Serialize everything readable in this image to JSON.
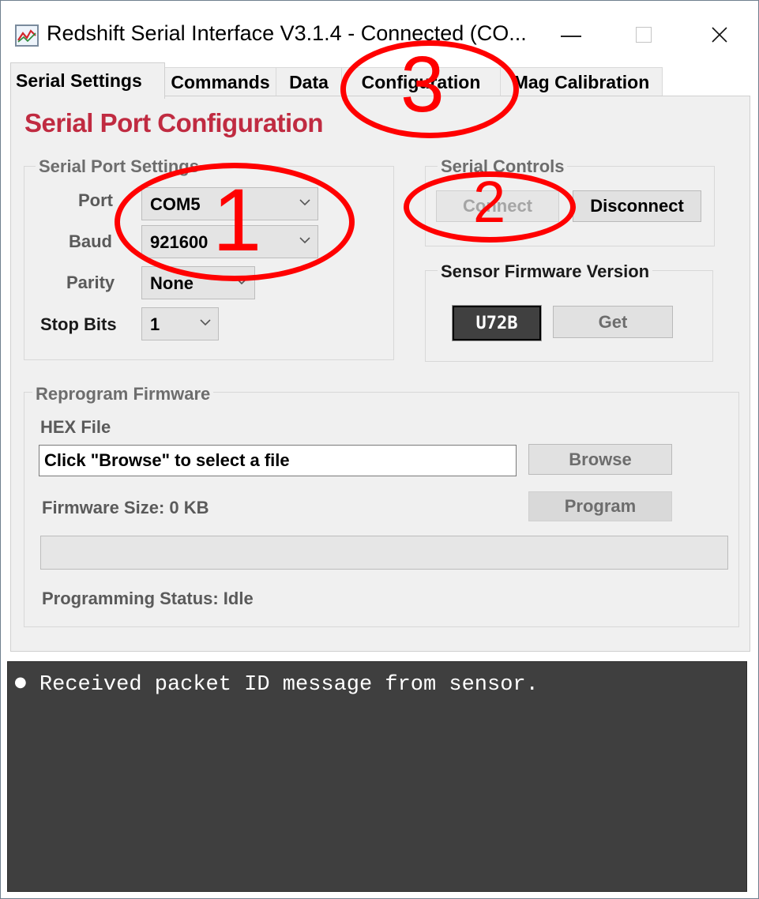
{
  "window": {
    "title": "Redshift Serial Interface V3.1.4 - Connected (CO...",
    "icon": "chart-line-icon"
  },
  "tabs": [
    {
      "label": "Serial Settings",
      "active": true
    },
    {
      "label": "Commands",
      "active": false
    },
    {
      "label": "Data",
      "active": false
    },
    {
      "label": "Configuration",
      "active": false
    },
    {
      "label": "Mag Calibration",
      "active": false
    }
  ],
  "page": {
    "title": "Serial Port Configuration",
    "accent_color": "#c02b41"
  },
  "serial_port_settings": {
    "group_label": "Serial Port Settings",
    "port": {
      "label": "Port",
      "value": "COM5"
    },
    "baud": {
      "label": "Baud",
      "value": "921600"
    },
    "parity": {
      "label": "Parity",
      "value": "None"
    },
    "stop_bits": {
      "label": "Stop Bits",
      "value": "1"
    }
  },
  "serial_controls": {
    "group_label": "Serial Controls",
    "connect_label": "Connect",
    "connect_enabled": false,
    "disconnect_label": "Disconnect"
  },
  "sensor_firmware": {
    "group_label": "Sensor Firmware Version",
    "version": "U72B",
    "get_label": "Get"
  },
  "reprogram": {
    "group_label": "Reprogram Firmware",
    "hex_label": "HEX File",
    "hex_value": "Click \"Browse\" to select a file",
    "browse_label": "Browse",
    "size_text": "Firmware Size: 0 KB",
    "program_label": "Program",
    "progress": 0,
    "status_text": "Programming Status: Idle"
  },
  "console": {
    "lines": [
      "Received packet ID message from sensor."
    ]
  },
  "annotations": [
    {
      "label": "1",
      "color": "#ff0000"
    },
    {
      "label": "2",
      "color": "#ff0000"
    },
    {
      "label": "3",
      "color": "#ff0000"
    }
  ]
}
